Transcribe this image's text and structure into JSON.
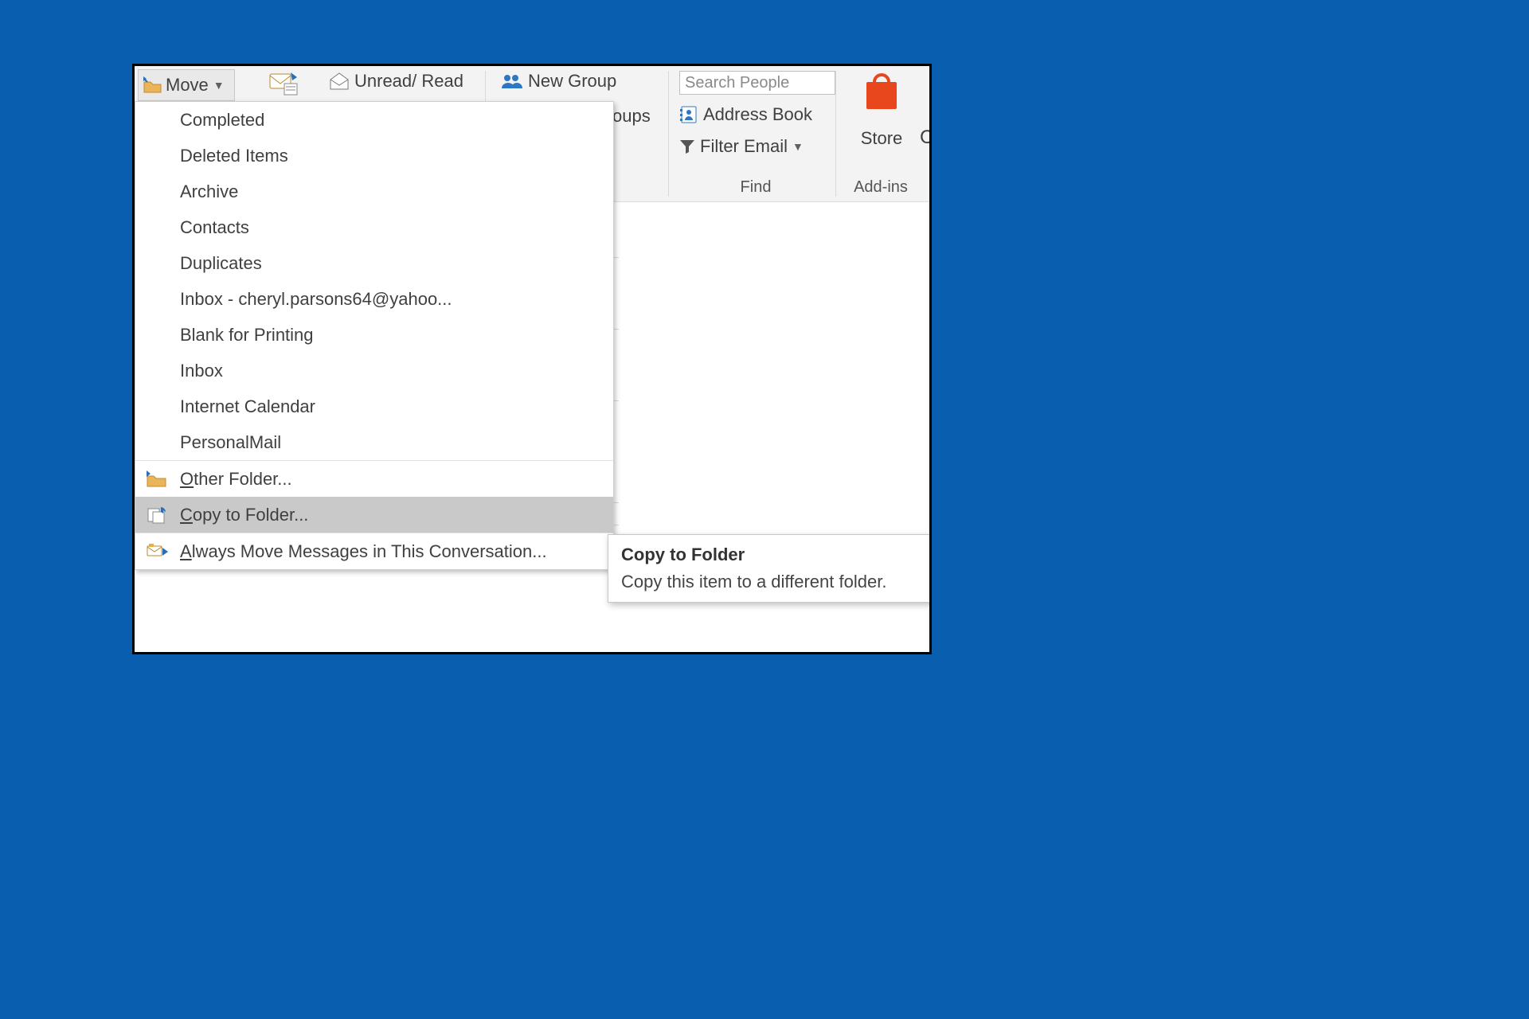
{
  "ribbon": {
    "move_label": "Move",
    "unread_label": "Unread/ Read",
    "newgroup_label": "New Group",
    "groups_fragment": "oups",
    "search_placeholder": "Search People",
    "address_book": "Address Book",
    "filter_email": "Filter Email",
    "find_group": "Find",
    "store_label": "Store",
    "addins_group": "Add-ins",
    "c_fragment": "C"
  },
  "menu": {
    "items": [
      "Completed",
      "Deleted Items",
      "Archive",
      "Contacts",
      "Duplicates",
      "Inbox - cheryl.parsons64@yahoo...",
      "Blank for Printing",
      "Inbox",
      "Internet Calendar",
      "PersonalMail"
    ],
    "other_folder": "Other Folder...",
    "copy_to_folder": "Copy to Folder...",
    "always_move": "Always Move Messages in This Conversation..."
  },
  "tooltip": {
    "title": "Copy to Folder",
    "body": "Copy this item to a different folder."
  }
}
